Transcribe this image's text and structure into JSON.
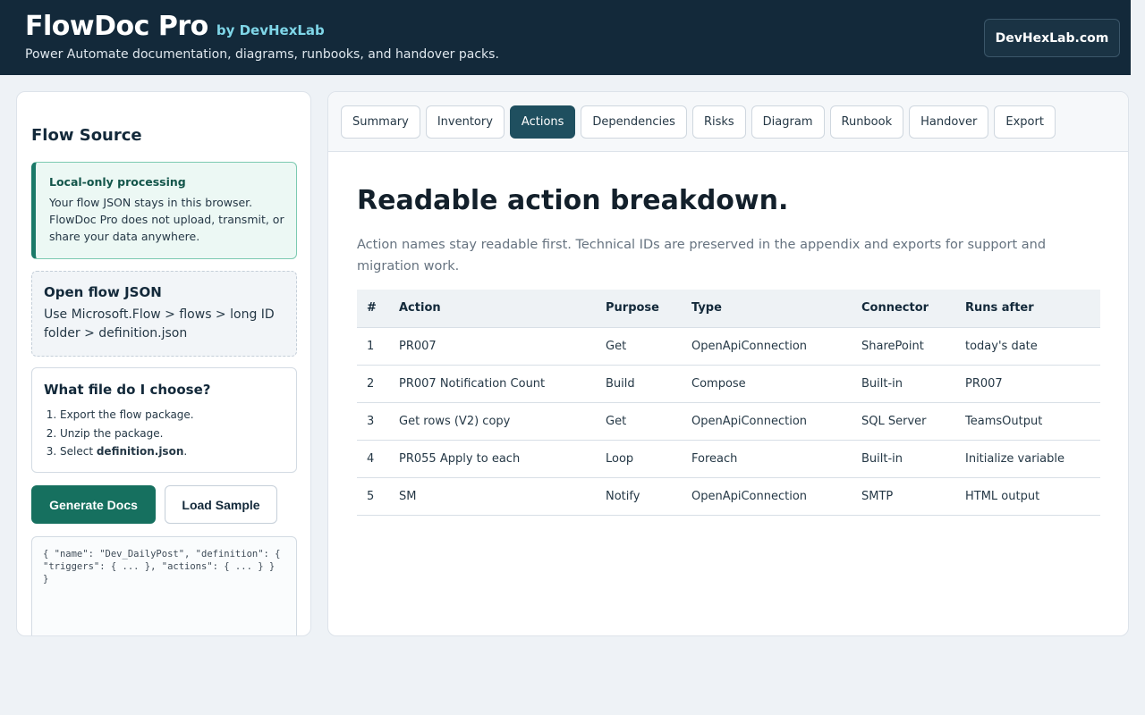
{
  "header": {
    "title": "FlowDoc Pro",
    "by": "by DevHexLab",
    "tagline": "Power Automate documentation, diagrams, runbooks, and handover packs.",
    "site_button": "DevHexLab.com"
  },
  "sidebar": {
    "title": "Flow Source",
    "notice": {
      "title": "Local-only processing",
      "text": "Your flow JSON stays in this browser. FlowDoc Pro does not upload, transmit, or share your data anywhere."
    },
    "open_card": {
      "title": "Open flow JSON",
      "text": "Use Microsoft.Flow > flows > long ID folder > definition.json"
    },
    "file_card": {
      "title": "What file do I choose?",
      "steps": [
        "Export the flow package.",
        "Unzip the package.",
        "Select "
      ],
      "step3_bold": "definition.json",
      "step3_suffix": "."
    },
    "generate_label": "Generate Docs",
    "sample_label": "Load Sample",
    "json_preview": "{ \"name\": \"Dev_DailyPost\", \"definition\": { \"triggers\": { ... }, \"actions\": { ... } } }"
  },
  "tabs": [
    "Summary",
    "Inventory",
    "Actions",
    "Dependencies",
    "Risks",
    "Diagram",
    "Runbook",
    "Handover",
    "Export"
  ],
  "active_tab": "Actions",
  "main": {
    "title": "Readable action breakdown.",
    "description": "Action names stay readable first. Technical IDs are preserved in the appendix and exports for support and migration work.",
    "columns": [
      "#",
      "Action",
      "Purpose",
      "Type",
      "Connector",
      "Runs after"
    ],
    "rows": [
      [
        "1",
        "PR007",
        "Get",
        "OpenApiConnection",
        "SharePoint",
        "today's date"
      ],
      [
        "2",
        "PR007 Notification Count",
        "Build",
        "Compose",
        "Built-in",
        "PR007"
      ],
      [
        "3",
        "Get rows (V2) copy",
        "Get",
        "OpenApiConnection",
        "SQL Server",
        "TeamsOutput"
      ],
      [
        "4",
        "PR055 Apply to each",
        "Loop",
        "Foreach",
        "Built-in",
        "Initialize variable"
      ],
      [
        "5",
        "SM",
        "Notify",
        "OpenApiConnection",
        "SMTP",
        "HTML output"
      ]
    ]
  },
  "colors": {
    "header_bg": "#13293a",
    "accent": "#16705f",
    "active_tab": "#1f4f5f",
    "by_text": "#7fd6e8"
  }
}
